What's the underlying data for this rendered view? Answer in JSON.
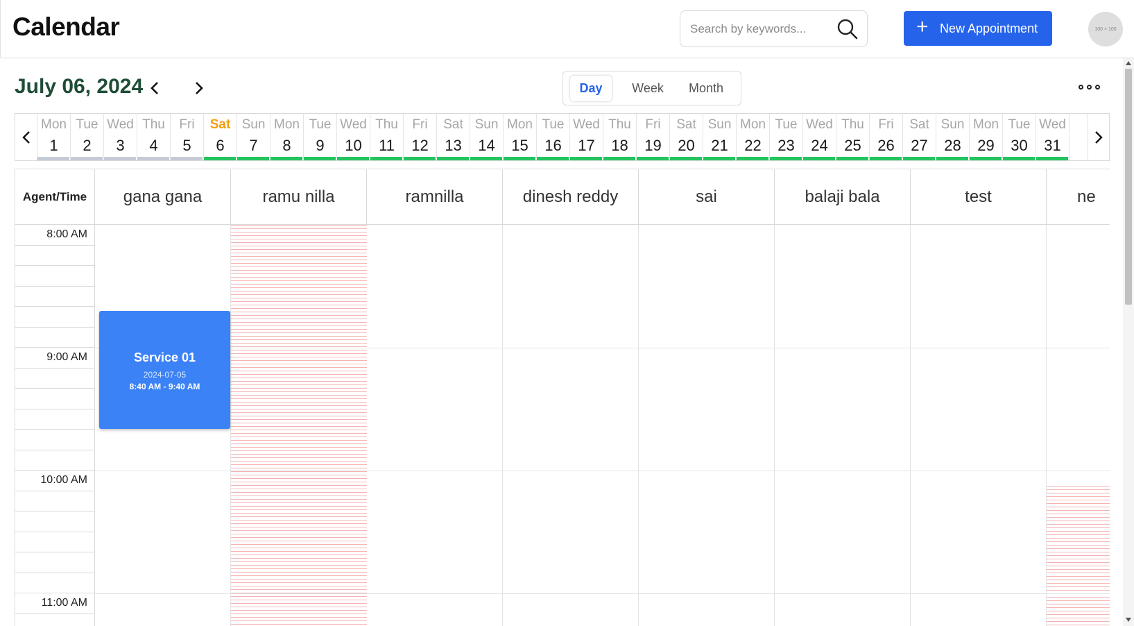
{
  "header": {
    "title": "Calendar",
    "search_placeholder": "Search by keywords...",
    "new_appointment_label": "New Appointment",
    "avatar_text": "100 × 100"
  },
  "toolbar": {
    "current_date": "July 06, 2024",
    "views": [
      "Day",
      "Week",
      "Month"
    ],
    "active_view": "Day"
  },
  "date_strip": [
    {
      "dn": "Mon",
      "dd": "1",
      "past": true
    },
    {
      "dn": "Tue",
      "dd": "2",
      "past": true
    },
    {
      "dn": "Wed",
      "dd": "3",
      "past": true
    },
    {
      "dn": "Thu",
      "dd": "4",
      "past": true
    },
    {
      "dn": "Fri",
      "dd": "5",
      "past": true
    },
    {
      "dn": "Sat",
      "dd": "6",
      "selected": true
    },
    {
      "dn": "Sun",
      "dd": "7"
    },
    {
      "dn": "Mon",
      "dd": "8"
    },
    {
      "dn": "Tue",
      "dd": "9"
    },
    {
      "dn": "Wed",
      "dd": "10"
    },
    {
      "dn": "Thu",
      "dd": "11"
    },
    {
      "dn": "Fri",
      "dd": "12"
    },
    {
      "dn": "Sat",
      "dd": "13"
    },
    {
      "dn": "Sun",
      "dd": "14"
    },
    {
      "dn": "Mon",
      "dd": "15"
    },
    {
      "dn": "Tue",
      "dd": "16"
    },
    {
      "dn": "Wed",
      "dd": "17"
    },
    {
      "dn": "Thu",
      "dd": "18"
    },
    {
      "dn": "Fri",
      "dd": "19"
    },
    {
      "dn": "Sat",
      "dd": "20"
    },
    {
      "dn": "Sun",
      "dd": "21"
    },
    {
      "dn": "Mon",
      "dd": "22"
    },
    {
      "dn": "Tue",
      "dd": "23"
    },
    {
      "dn": "Wed",
      "dd": "24"
    },
    {
      "dn": "Thu",
      "dd": "25"
    },
    {
      "dn": "Fri",
      "dd": "26"
    },
    {
      "dn": "Sat",
      "dd": "27"
    },
    {
      "dn": "Sun",
      "dd": "28"
    },
    {
      "dn": "Mon",
      "dd": "29"
    },
    {
      "dn": "Tue",
      "dd": "30"
    },
    {
      "dn": "Wed",
      "dd": "31"
    }
  ],
  "grid": {
    "corner_label": "Agent/Time",
    "agents": [
      "gana gana",
      "ramu nilla",
      "ramnilla",
      "dinesh reddy",
      "sai",
      "balaji bala",
      "test",
      "ne"
    ],
    "time_labels": [
      "8:00 AM",
      "9:00 AM",
      "10:00 AM",
      "11:00 AM"
    ]
  },
  "appointment": {
    "service": "Service 01",
    "date": "2024-07-05",
    "time": "8:40 AM - 9:40 AM"
  },
  "colors": {
    "primary": "#2563eb",
    "appointment": "#3b82f6",
    "available_bar": "#22c55e",
    "past_bar": "#c5cbd6",
    "selected_day": "#f59e0b",
    "date_title": "#1f4d36",
    "blocked_stripe": "#f7b3b3"
  }
}
